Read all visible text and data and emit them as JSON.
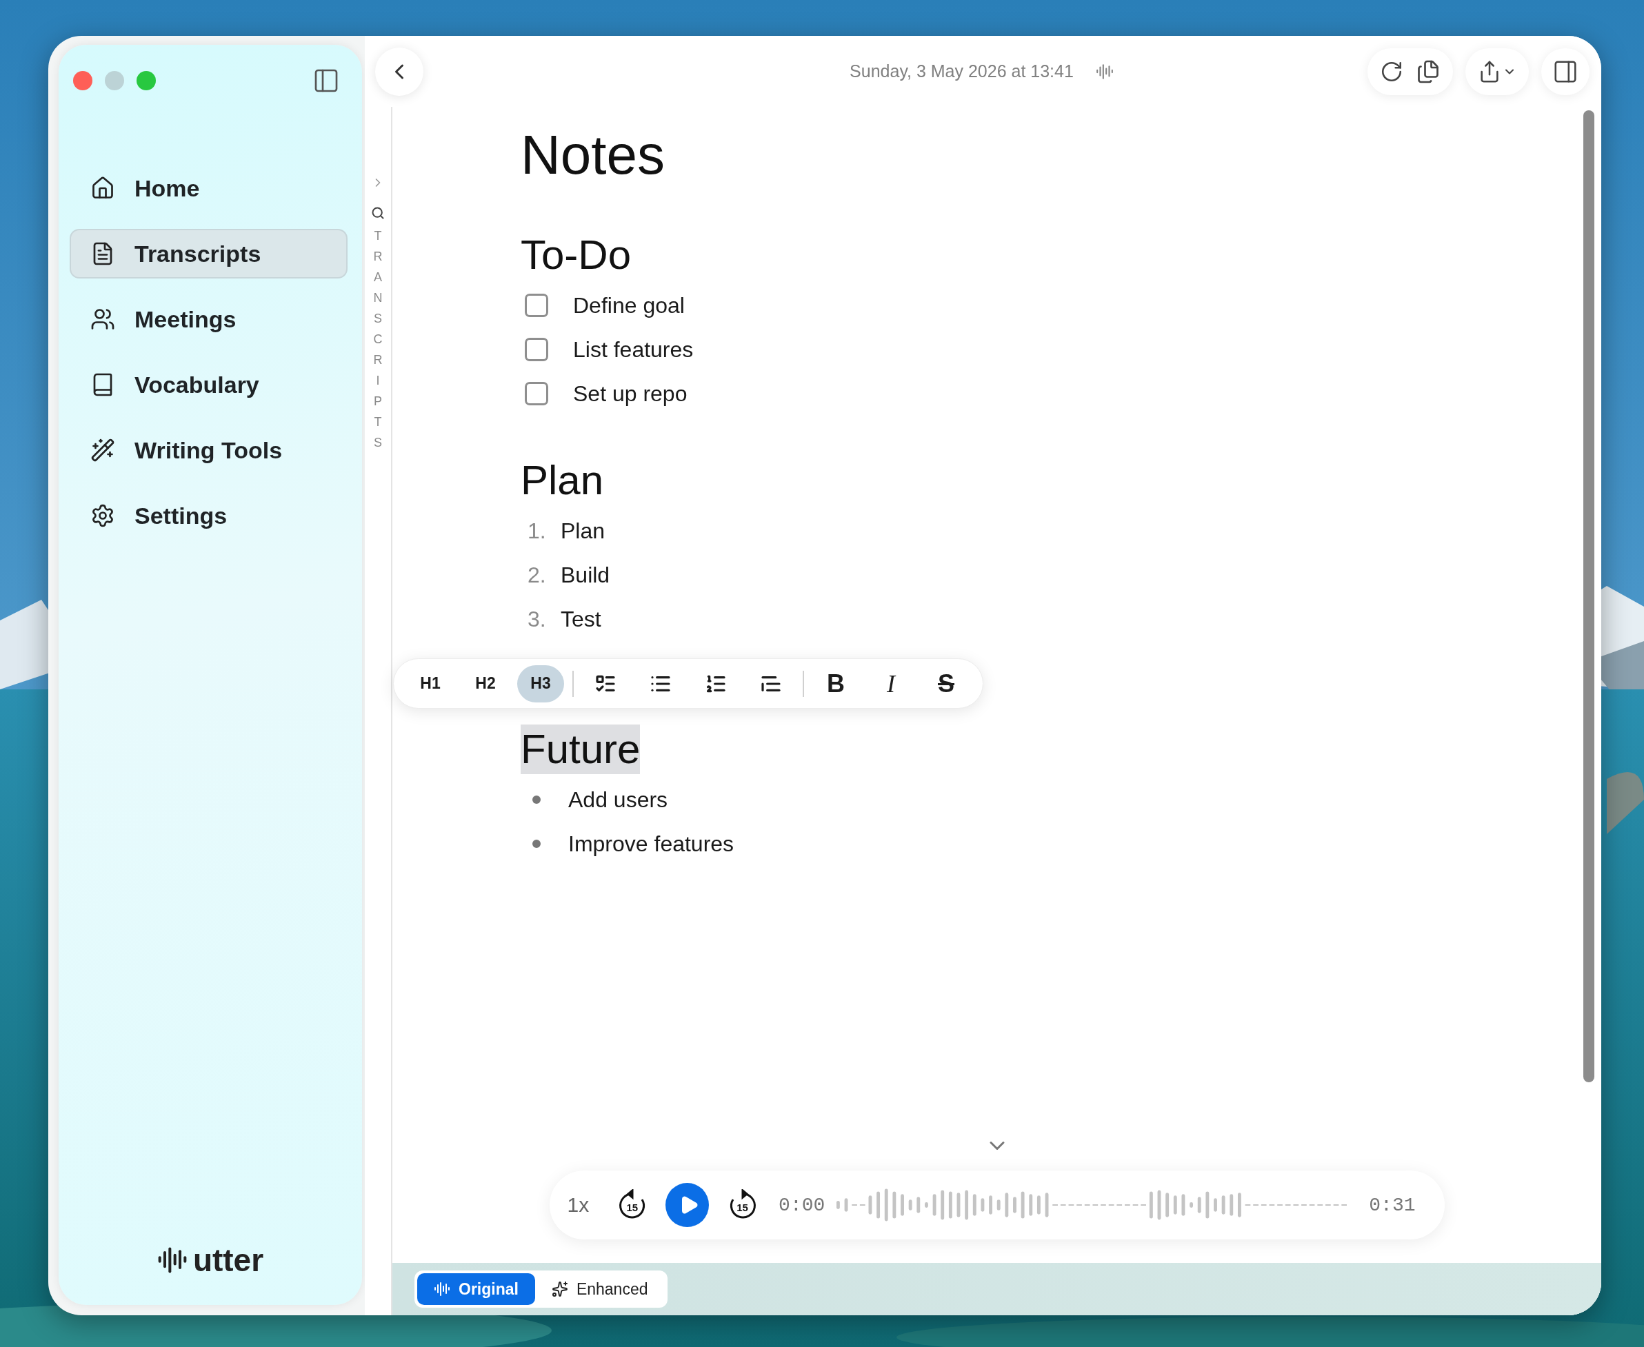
{
  "sidebar": {
    "items": [
      {
        "label": "Home",
        "selected": false
      },
      {
        "label": "Transcripts",
        "selected": true
      },
      {
        "label": "Meetings",
        "selected": false
      },
      {
        "label": "Vocabulary",
        "selected": false
      },
      {
        "label": "Writing Tools",
        "selected": false
      },
      {
        "label": "Settings",
        "selected": false
      }
    ],
    "brand": "utter"
  },
  "index_strip": {
    "label": "TRANSCRIPTS"
  },
  "header": {
    "date": "Sunday, 3 May 2026 at 13:41"
  },
  "document": {
    "title": "Notes",
    "sections": [
      {
        "heading": "To-Do",
        "selected": false,
        "kind": "checklist",
        "items": [
          {
            "text": "Define goal",
            "checked": false
          },
          {
            "text": "List features",
            "checked": false
          },
          {
            "text": "Set up repo",
            "checked": false
          }
        ]
      },
      {
        "heading": "Plan",
        "selected": false,
        "kind": "numbered",
        "items": [
          {
            "marker": "1.",
            "text": "Plan"
          },
          {
            "marker": "2.",
            "text": "Build"
          },
          {
            "marker": "3.",
            "text": "Test"
          }
        ]
      },
      {
        "heading": "Future",
        "selected": true,
        "kind": "bulleted",
        "items": [
          {
            "text": "Add users"
          },
          {
            "text": "Improve features"
          }
        ]
      }
    ]
  },
  "format_toolbar": {
    "groups": [
      [
        {
          "kind": "text",
          "label": "H1",
          "selected": false
        },
        {
          "kind": "text",
          "label": "H2",
          "selected": false
        },
        {
          "kind": "text",
          "label": "H3",
          "selected": true
        }
      ],
      [
        {
          "kind": "task-list",
          "selected": false
        },
        {
          "kind": "bullet-list",
          "selected": false
        },
        {
          "kind": "numbered-list",
          "selected": false
        },
        {
          "kind": "quote",
          "selected": false
        }
      ],
      [
        {
          "kind": "bold",
          "label": "B",
          "selected": false
        },
        {
          "kind": "italic",
          "label": "I",
          "selected": false
        },
        {
          "kind": "strike",
          "label": "S",
          "selected": false
        }
      ]
    ]
  },
  "player": {
    "speed": "1x",
    "skip_back": "15",
    "skip_forward": "15",
    "playing": false,
    "elapsed": "0:00",
    "duration": "0:31"
  },
  "view_tabs": [
    {
      "label": "Original",
      "selected": true
    },
    {
      "label": "Enhanced",
      "selected": false
    }
  ]
}
